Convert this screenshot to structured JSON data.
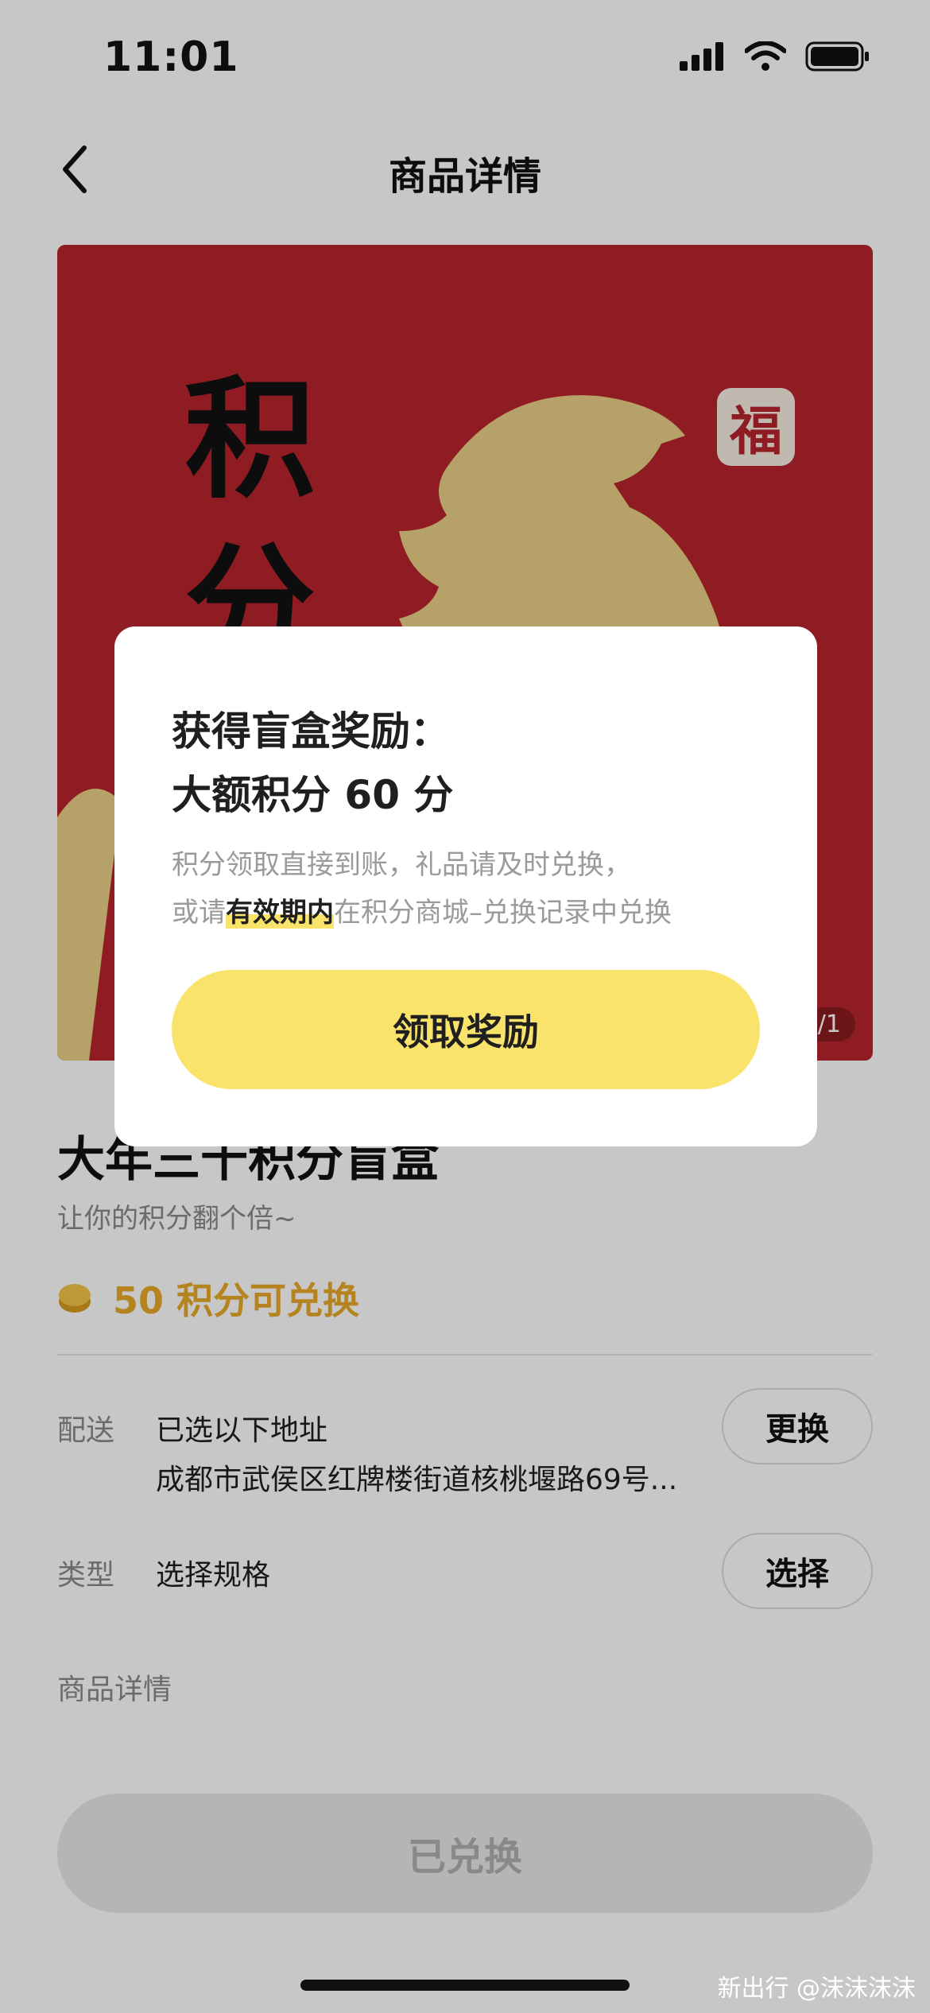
{
  "status_bar": {
    "time": "11:01"
  },
  "nav": {
    "title": "商品详情"
  },
  "banner": {
    "text_line1": "积",
    "text_line2": "分",
    "seal_char": "福",
    "page_indicator": "/1"
  },
  "product": {
    "title": "大年三十积分盲盒",
    "subtitle": "让你的积分翻个倍~",
    "price_text": "50 积分可兑换"
  },
  "delivery": {
    "label": "配送",
    "value_line1": "已选以下地址",
    "value_line2": "成都市武侯区红牌楼街道核桃堰路69号...",
    "button": "更换"
  },
  "spec": {
    "label": "类型",
    "value": "选择规格",
    "button": "选择"
  },
  "details_label": "商品详情",
  "bottom_button": "已兑换",
  "modal": {
    "title": "获得盲盒奖励：",
    "amount": "大额积分 60 分",
    "desc_line1": "积分领取直接到账，礼品请及时兑换，",
    "desc_prefix": "或请",
    "desc_highlight": "有效期内",
    "desc_suffix": "在积分商城–兑换记录中兑换",
    "button": "领取奖励"
  },
  "watermark": "新出行 @沫沫沫沫",
  "colors": {
    "accent_yellow": "#fae36a",
    "price_orange": "#e8a92a",
    "banner_red": "#b8252d",
    "tiger_gold": "#e9cf86"
  }
}
